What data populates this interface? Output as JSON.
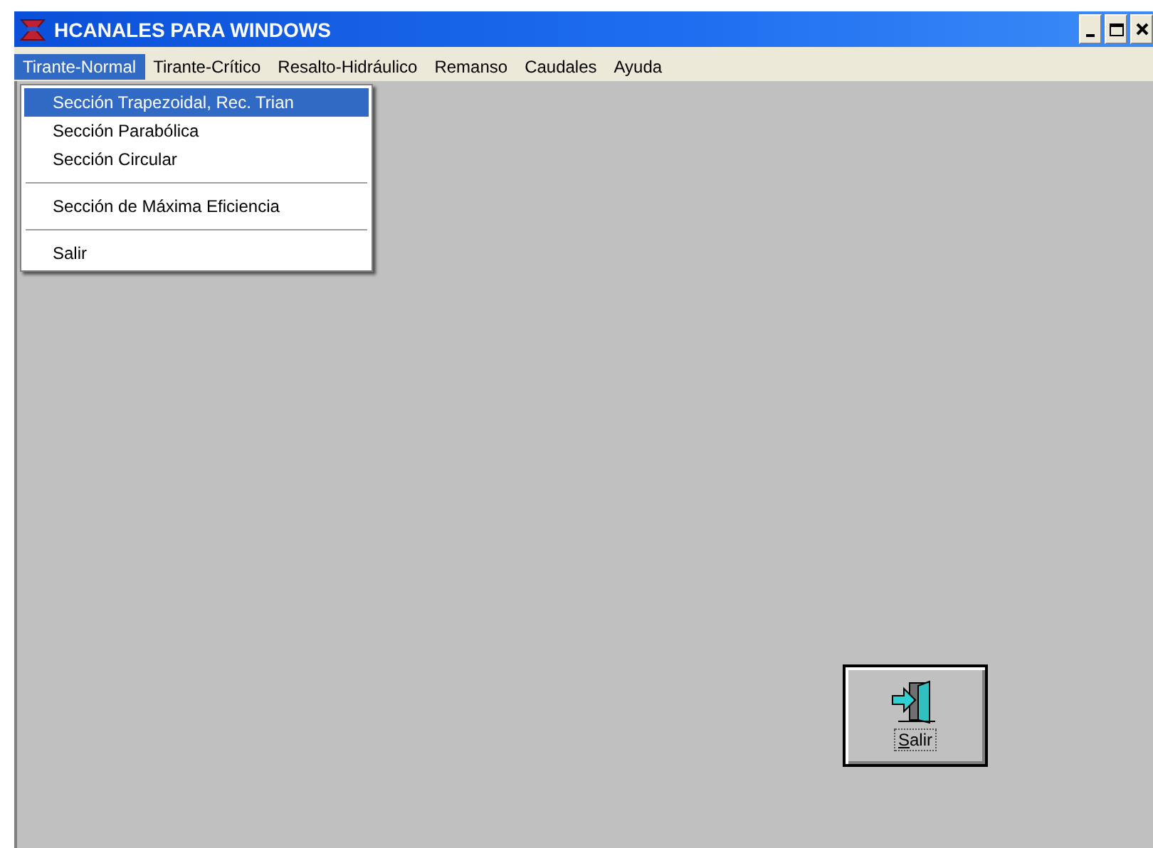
{
  "window": {
    "title": "HCANALES PARA WINDOWS"
  },
  "menu_bar": [
    {
      "label": "Tirante-Normal",
      "selected": true
    },
    {
      "label": "Tirante-Crítico",
      "selected": false
    },
    {
      "label": "Resalto-Hidráulico",
      "selected": false
    },
    {
      "label": "Remanso",
      "selected": false
    },
    {
      "label": "Caudales",
      "selected": false
    },
    {
      "label": "Ayuda",
      "selected": false
    }
  ],
  "dropdown_menu": [
    {
      "kind": "item",
      "label": "Sección Trapezoidal, Rec. Trian",
      "selected": true
    },
    {
      "kind": "item",
      "label": "Sección Parabólica",
      "selected": false
    },
    {
      "kind": "item",
      "label": "Sección Circular",
      "selected": false
    },
    {
      "kind": "separator"
    },
    {
      "kind": "item",
      "label": "Sección de Máxima Eficiencia",
      "selected": false
    },
    {
      "kind": "separator"
    },
    {
      "kind": "item",
      "label": "Salir",
      "selected": false
    }
  ],
  "exit_button": {
    "label": "Salir"
  }
}
